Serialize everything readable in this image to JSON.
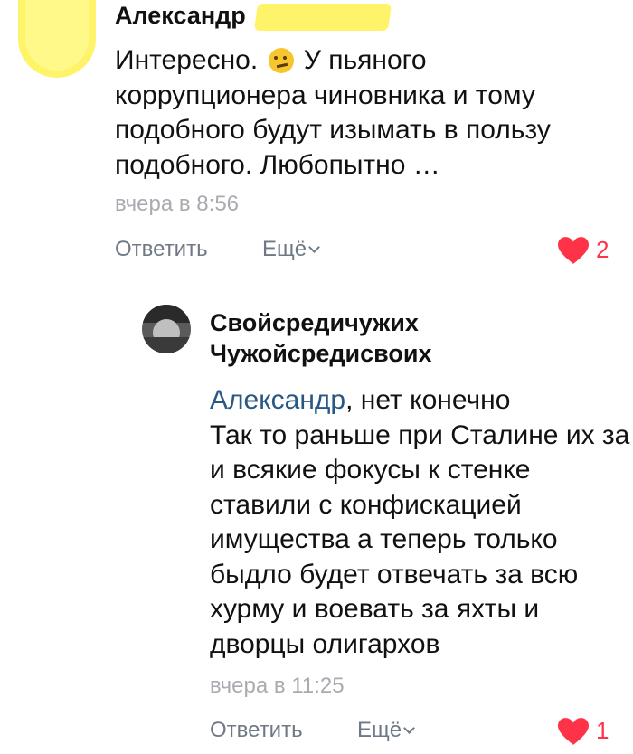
{
  "comment1": {
    "author": "Александр",
    "text_before_emoji": "Интересно.",
    "emoji": "thinking-face-emoji",
    "text_after_emoji": "У пьяного коррупционера чиновника и тому подобного будут изымать в пользу подобного. Любопытно …",
    "time": "вчера в 8:56",
    "reply_label": "Ответить",
    "more_label": "Ещё",
    "like_count": "2"
  },
  "comment2": {
    "author": "Свойсредичужих Чужойсредисвоих",
    "mention": "Александр",
    "text_line1_rest": ", нет конечно",
    "text_rest": "Так то раньше при Сталине их за и всякие фокусы к стенке ставили с конфискацией имущества а теперь только быдло будет отвечать за всю хурму и воевать за яхты и дворцы олигархов",
    "time": "вчера в 11:25",
    "reply_label": "Ответить",
    "more_label": "Ещё",
    "like_count": "1"
  },
  "colors": {
    "like": "#ff3347",
    "mention": "#2a5885",
    "muted": "#a8abb0",
    "action": "#6f7985"
  }
}
